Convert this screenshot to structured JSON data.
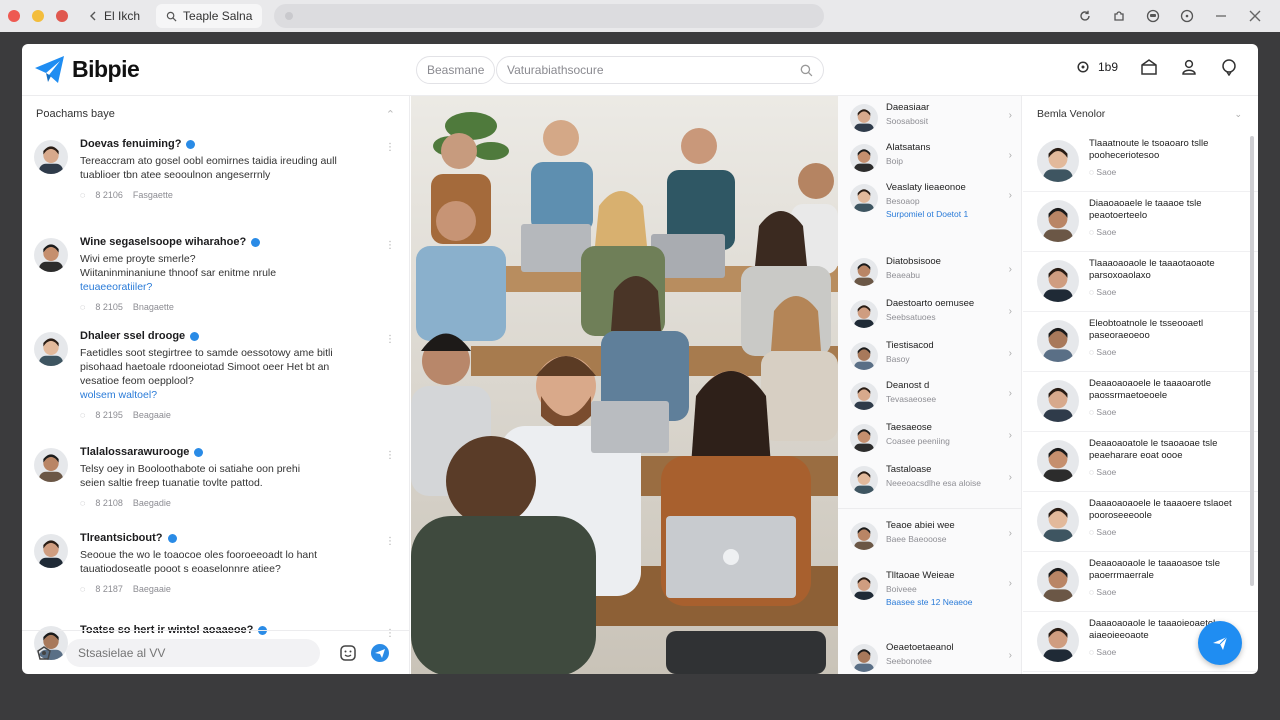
{
  "browser": {
    "tabs": [
      "El Ikch",
      "Teaple Salna"
    ],
    "address": ""
  },
  "app": {
    "brand": "Bibpie",
    "search_pill": "Beasmane",
    "search_placeholder": "Vaturabiathsocure",
    "counter": "1b9",
    "accent": "#1f8df2"
  },
  "feed": {
    "header": "Poachams baye",
    "posts": [
      {
        "title": "Doevas fenuiming?",
        "lines": [
          "Tereaccram ato gosel oobl eomirnes taidia ireuding aull",
          "tuablioer tbn atee seooulnon angeserrnly"
        ],
        "link": "",
        "meta": [
          "8 2106",
          "Fasgaette"
        ]
      },
      {
        "title": "Wine segaselsoope wiharahoe?",
        "lines": [
          "Wivi eme proyte smerle?",
          "Wiitaninminaniune thnoof sar enitme nrule"
        ],
        "link": "teuaeeoratiiler?",
        "meta": [
          "8 2105",
          "Bnagaette"
        ]
      },
      {
        "title": "Dhaleer ssel drooge",
        "lines": [
          "Faetidles soot stegirtree to samde oessotowy ame bitli",
          "pisohaad haetoale rdooneiotad Simoot oeer Het bt an",
          "vesatioe feom oepplool?"
        ],
        "link": "wolsem waltoel?",
        "meta": [
          "8 2195",
          "Beagaaie"
        ]
      },
      {
        "title": "Tlalalossarawurooge",
        "lines": [
          "Telsy oey in Booloothabote oi satiahe oon prehi",
          "seien saltie freep tuanatie tovlte pattod."
        ],
        "link": "",
        "meta": [
          "8 2108",
          "Baegadie"
        ]
      },
      {
        "title": "Tlreantsicbout?",
        "lines": [
          "Seooue the wo le toaocoe oles fooroeeoadt lo hant",
          "tauatiodoseatle pooot s eoaselonnre atiee?"
        ],
        "link": "",
        "meta": [
          "8 2187",
          "Baegaaie"
        ]
      },
      {
        "title": "Toatse so hert ir wintol aoaaeoe?",
        "lines": [],
        "link": "",
        "meta": []
      }
    ],
    "composer_placeholder": "Stsasielae al VV"
  },
  "people": [
    {
      "name": "Daeasiaar",
      "sub": "Soosabosit",
      "link": ""
    },
    {
      "name": "Alatsatans",
      "sub": "Boip",
      "link": ""
    },
    {
      "name": "Veaslaty lieaeonoe",
      "sub": "Besoaop",
      "link": "Surpomiel ot Doetot 1"
    },
    {
      "name": "Diatobsisooe",
      "sub": "Beaeabu",
      "link": ""
    },
    {
      "name": "Daestoarto oemusee",
      "sub": "Seebsatuoes",
      "link": ""
    },
    {
      "name": "Tiestisacod",
      "sub": "Basoy",
      "link": ""
    },
    {
      "name": "Deanost d",
      "sub": "Tevasaeosee",
      "link": ""
    },
    {
      "name": "Taesaeose",
      "sub": "Coasee peeniing",
      "link": ""
    },
    {
      "name": "Tastaloase",
      "sub": "Neeeoacsdlhe esa aloise",
      "link": ""
    },
    {
      "name": "Teaoe abiei wee",
      "sub": "Baee Baeooose",
      "link": ""
    },
    {
      "name": "Tlltaoae Weieae",
      "sub": "Boiveee",
      "link": "Baasee ste 12 Neaeoe"
    },
    {
      "name": "Oeaetoetaeanol",
      "sub": "Seebonotee",
      "link": ""
    }
  ],
  "right_panel": {
    "header": "Bemla Venolor",
    "items": [
      {
        "title": "Tlaaatnoute le tsoaoaro tslle pooheceriotesoo",
        "meta": "Saoe"
      },
      {
        "title": "Diaaoaoaele le taaaoe tsle peaotoerteelo",
        "meta": "Saoe"
      },
      {
        "title": "Tlaaaoaoaole le taaaotaoaote parsoxoaolaxo",
        "meta": "Saoe"
      },
      {
        "title": "Eleobtoatnole le tsseooaetl paseoraeoeoo",
        "meta": "Saoe"
      },
      {
        "title": "Deaaoaoaoele le taaaoarotle paossrmaetoeoele",
        "meta": "Saoe"
      },
      {
        "title": "Deaaoaoatole le tsaoaoae tsle peaeharare eoat oooe",
        "meta": "Saoe"
      },
      {
        "title": "Daaaoaoaoele le taaaoere tslaoet pooroseeeoole",
        "meta": "Saoe"
      },
      {
        "title": "Deaaoaoaole le taaaoasoe tsle paoerrmaerrale",
        "meta": "Saoe"
      },
      {
        "title": "Daaaoaoaole le taaaoieoaetol aiaeoieeoaote",
        "meta": "Saoe"
      }
    ]
  }
}
